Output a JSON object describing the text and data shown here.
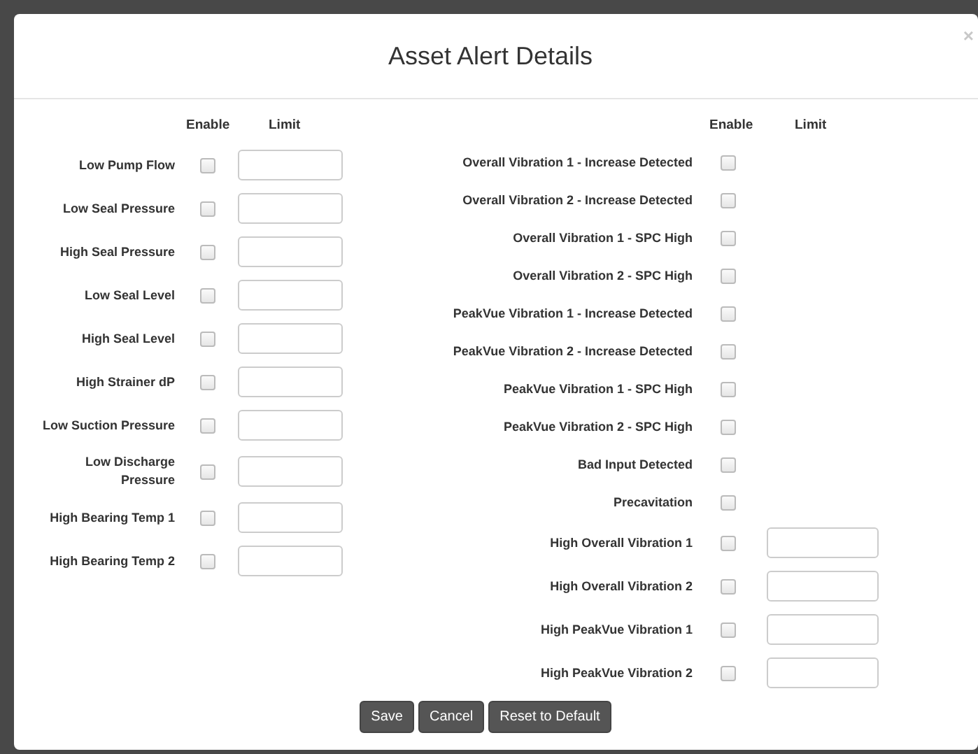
{
  "dialog": {
    "title": "Asset Alert Details",
    "close": "×"
  },
  "left": {
    "headers": [
      "Enable",
      "Limit"
    ],
    "rows": [
      {
        "label": "Low Pump Flow",
        "kind": "limit",
        "checked": false
      },
      {
        "label": "Low Seal Pressure",
        "kind": "limit",
        "checked": false
      },
      {
        "label": "High Seal Pressure",
        "kind": "limit",
        "checked": false
      },
      {
        "label": "Low Seal Level",
        "kind": "limit",
        "checked": false
      },
      {
        "label": "High Seal Level",
        "kind": "limit",
        "checked": false
      },
      {
        "label": "High Strainer dP",
        "kind": "limit",
        "checked": false
      },
      {
        "label": "Low Suction Pressure",
        "kind": "limit",
        "checked": false
      },
      {
        "label": "Low Discharge Pressure",
        "kind": "limit",
        "checked": false
      },
      {
        "label": "High Bearing Temp 1",
        "kind": "limit",
        "checked": false
      },
      {
        "label": "High Bearing Temp 2",
        "kind": "limit",
        "checked": false
      }
    ]
  },
  "right": {
    "headers": [
      "Enable",
      "Limit"
    ],
    "rows": [
      {
        "label": "Overall Vibration 1 - Increase Detected",
        "kind": "flag",
        "checked": false
      },
      {
        "label": "Overall Vibration 2 - Increase Detected",
        "kind": "flag",
        "checked": false
      },
      {
        "label": "Overall Vibration 1 - SPC High",
        "kind": "flag",
        "checked": false
      },
      {
        "label": "Overall Vibration 2 - SPC High",
        "kind": "flag",
        "checked": false
      },
      {
        "label": "PeakVue Vibration 1 - Increase Detected",
        "kind": "flag",
        "checked": false
      },
      {
        "label": "PeakVue Vibration 2 - Increase Detected",
        "kind": "flag",
        "checked": false
      },
      {
        "label": "PeakVue Vibration 1 - SPC High",
        "kind": "flag",
        "checked": false
      },
      {
        "label": "PeakVue Vibration 2 - SPC High",
        "kind": "flag",
        "checked": false
      },
      {
        "label": "Bad Input Detected",
        "kind": "flag",
        "checked": false
      },
      {
        "label": "Precavitation",
        "kind": "flag",
        "checked": false
      },
      {
        "label": "High Overall Vibration 1",
        "kind": "limit",
        "checked": false
      },
      {
        "label": "High Overall Vibration 2",
        "kind": "limit",
        "checked": false
      },
      {
        "label": "High PeakVue Vibration 1",
        "kind": "limit",
        "checked": false
      },
      {
        "label": "High PeakVue Vibration 2",
        "kind": "limit",
        "checked": false
      }
    ]
  },
  "buttons": [
    "Save",
    "Cancel",
    "Reset to Default"
  ]
}
